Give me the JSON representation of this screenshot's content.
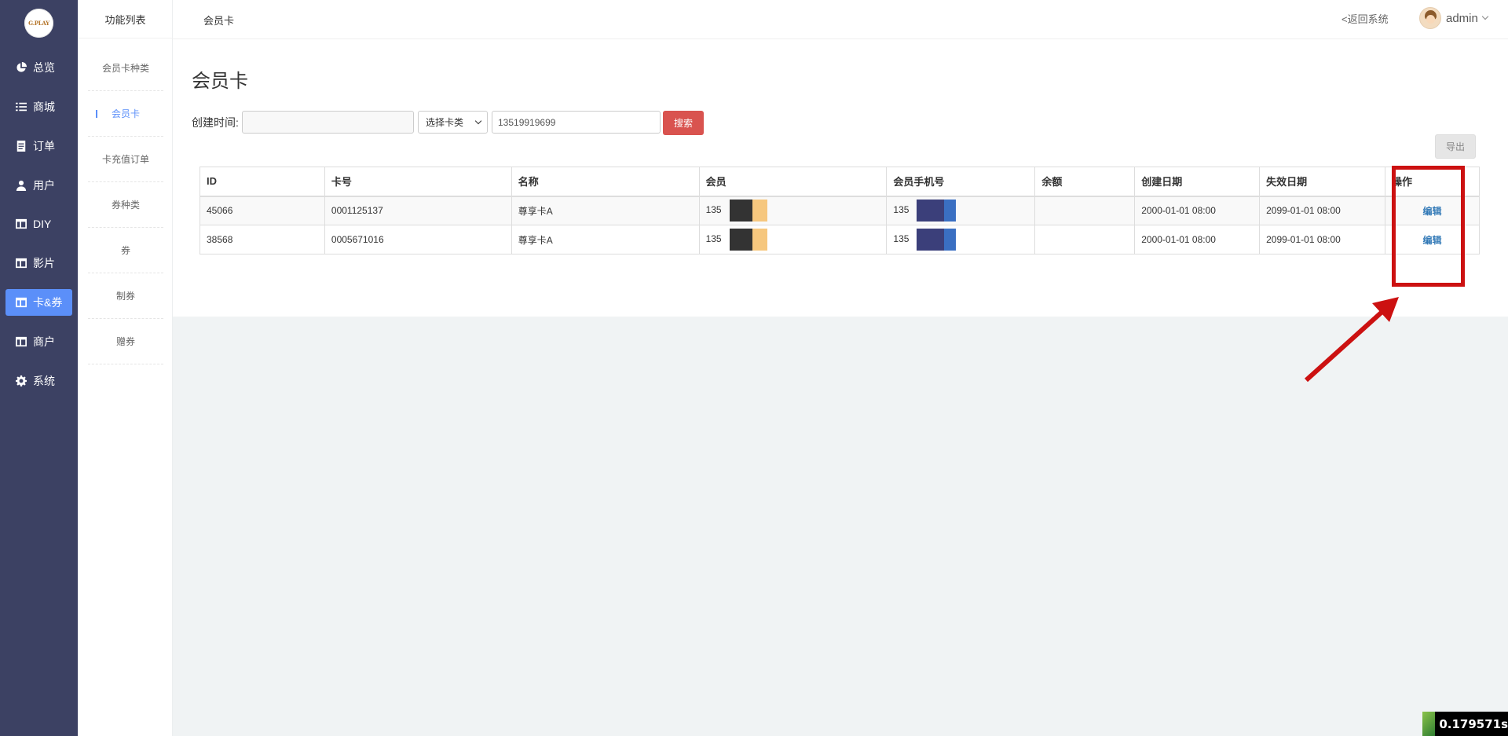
{
  "logo": {
    "text": "G.PLAY"
  },
  "sidebar": {
    "items": [
      {
        "label": "总览",
        "icon": "pie-chart-icon"
      },
      {
        "label": "商城",
        "icon": "list-icon"
      },
      {
        "label": "订单",
        "icon": "document-icon"
      },
      {
        "label": "用户",
        "icon": "user-icon"
      },
      {
        "label": "DIY",
        "icon": "layout-icon"
      },
      {
        "label": "影片",
        "icon": "layout-icon"
      },
      {
        "label": "卡&券",
        "icon": "layout-icon",
        "active": true
      },
      {
        "label": "商户",
        "icon": "layout-icon"
      },
      {
        "label": "系统",
        "icon": "gear-icon"
      }
    ]
  },
  "subnav": {
    "title": "功能列表",
    "items": [
      {
        "label": "会员卡种类"
      },
      {
        "label": "会员卡",
        "active": true
      },
      {
        "label": "卡充值订单"
      },
      {
        "label": "券种类"
      },
      {
        "label": "券"
      },
      {
        "label": "制券"
      },
      {
        "label": "赠券"
      }
    ]
  },
  "header": {
    "breadcrumb": "会员卡",
    "back_label": "<返回系统",
    "user_name": "admin"
  },
  "main": {
    "title": "会员卡",
    "filter": {
      "date_label": "创建时间:",
      "date_value": "",
      "type_select": "选择卡类",
      "phone_value": "13519919699",
      "search_label": "搜索"
    },
    "export_label": "导出",
    "table": {
      "columns": [
        "ID",
        "卡号",
        "名称",
        "会员",
        "会员手机号",
        "余额",
        "创建日期",
        "失效日期",
        "操作"
      ],
      "rows": [
        {
          "id": "45066",
          "card_no": "0001125137",
          "name": "尊享卡A",
          "member": "135",
          "phone": "135",
          "balance": "",
          "created": "2000-01-01 08:00",
          "expires": "2099-01-01 08:00",
          "action": "编辑"
        },
        {
          "id": "38568",
          "card_no": "0005671016",
          "name": "尊享卡A",
          "member": "135",
          "phone": "135",
          "balance": "",
          "created": "2000-01-01 08:00",
          "expires": "2099-01-01 08:00",
          "action": "编辑"
        }
      ]
    }
  },
  "timing_badge": "0.179571s",
  "colors": {
    "sidebar_bg": "#3c4163",
    "accent": "#5b8ff9",
    "search_button": "#d9534f",
    "annotation": "#cc1111",
    "link": "#337ab7"
  }
}
